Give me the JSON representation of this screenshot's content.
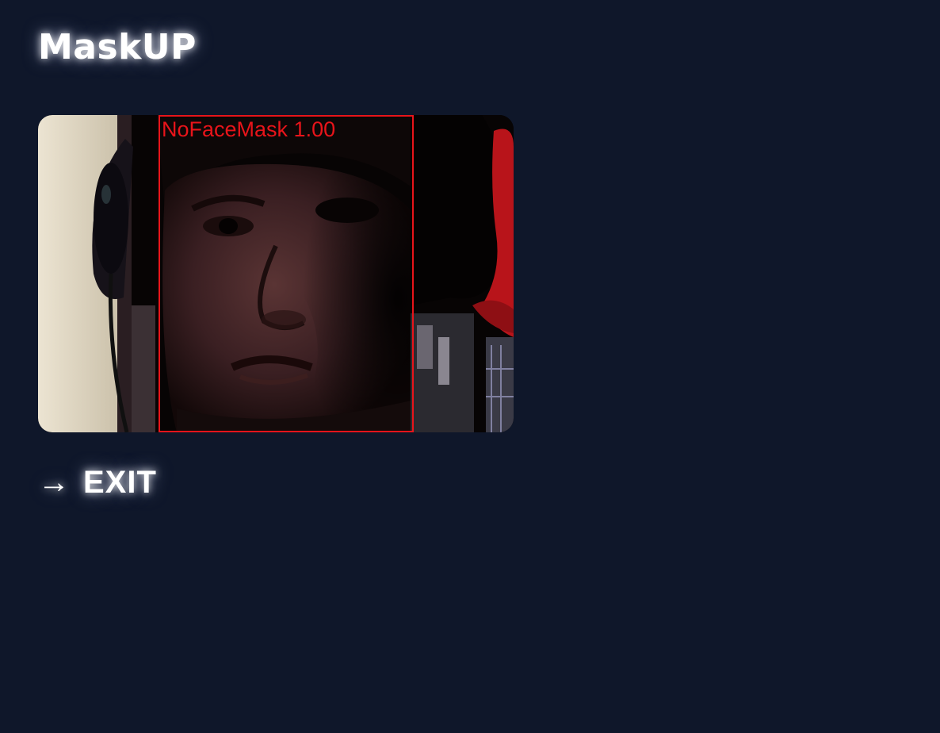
{
  "app": {
    "title": "MaskUP"
  },
  "video": {
    "detection": {
      "label": "NoFaceMask 1.00",
      "class": "NoFaceMask",
      "confidence": 1.0,
      "color": "#e8141a"
    }
  },
  "exit": {
    "arrow": "→",
    "label": "EXIT"
  },
  "colors": {
    "background": "#0f172a",
    "text": "#ffffff",
    "detection": "#e8141a"
  }
}
